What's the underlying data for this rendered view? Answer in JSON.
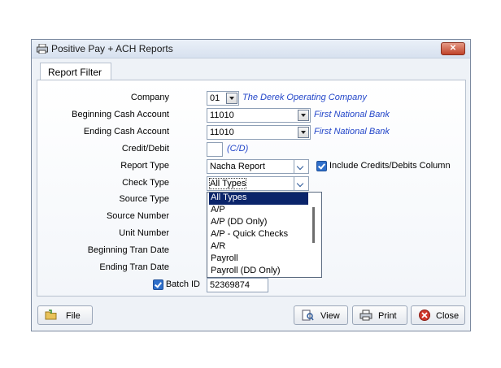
{
  "window": {
    "title": "Positive Pay + ACH Reports",
    "icon": "printer-icon"
  },
  "tab": {
    "label": "Report Filter"
  },
  "form": {
    "company": {
      "label": "Company",
      "value": "01",
      "info": "The Derek Operating Company"
    },
    "beginning_cash": {
      "label": "Beginning Cash Account",
      "value": "11010",
      "info": "First National Bank"
    },
    "ending_cash": {
      "label": "Ending Cash Account",
      "value": "11010",
      "info": "First National Bank"
    },
    "credit_debit": {
      "label": "Credit/Debit",
      "value": "",
      "hint": "(C/D)"
    },
    "report_type": {
      "label": "Report Type",
      "value": "Nacha Report"
    },
    "include_credits": {
      "label": "Include Credits/Debits Column",
      "checked": true
    },
    "check_type": {
      "label": "Check Type",
      "value": "All Types"
    },
    "source_type": {
      "label": "Source Type"
    },
    "source_number": {
      "label": "Source Number"
    },
    "unit_number": {
      "label": "Unit Number"
    },
    "beginning_tran_date": {
      "label": "Beginning Tran Date"
    },
    "ending_tran_date": {
      "label": "Ending Tran Date"
    },
    "batch_id": {
      "label": "Batch ID",
      "checked": true,
      "value": "52369874"
    }
  },
  "check_type_options": [
    "All Types",
    "A/P",
    "A/P (DD Only)",
    "A/P - Quick Checks",
    "A/R",
    "Payroll",
    "Payroll (DD Only)"
  ],
  "buttons": {
    "file": "File",
    "view": "View",
    "print": "Print",
    "close": "Close"
  },
  "colors": {
    "accent": "#2346c9",
    "selection": "#0a246a",
    "close_red": "#c0432a"
  }
}
